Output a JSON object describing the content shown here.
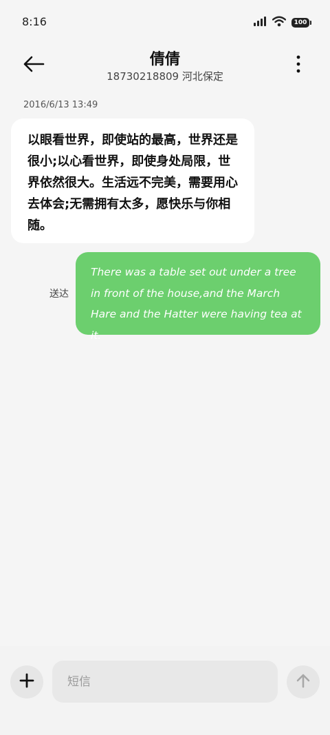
{
  "status_bar": {
    "time": "8:16",
    "battery": "100",
    "icons": [
      "signal-icon",
      "wifi-icon",
      "battery-icon"
    ]
  },
  "header": {
    "contact_name": "倩倩",
    "contact_sub": "18730218809 河北保定",
    "icons": [
      "back-arrow-icon",
      "more-vertical-icon"
    ]
  },
  "conversation": {
    "timestamp": "2016/6/13 13:49",
    "incoming_message": "以眼看世界，即使站的最高，世界还是很小;以心看世界，即使身处局限，世界依然很大。生活远不完美，需要用心去体会;无需拥有太多，愿快乐与你相随。",
    "outgoing_status": "送达",
    "outgoing_message": "There was a table set out under a tree in front of the house,and the March Hare and the Hatter were having tea at it."
  },
  "composer": {
    "placeholder": "短信",
    "icons": [
      "plus-icon",
      "send-arrow-icon"
    ]
  },
  "colors": {
    "background": "#f5f5f5",
    "incoming_bubble": "#ffffff",
    "outgoing_bubble": "#6ccf6e"
  }
}
